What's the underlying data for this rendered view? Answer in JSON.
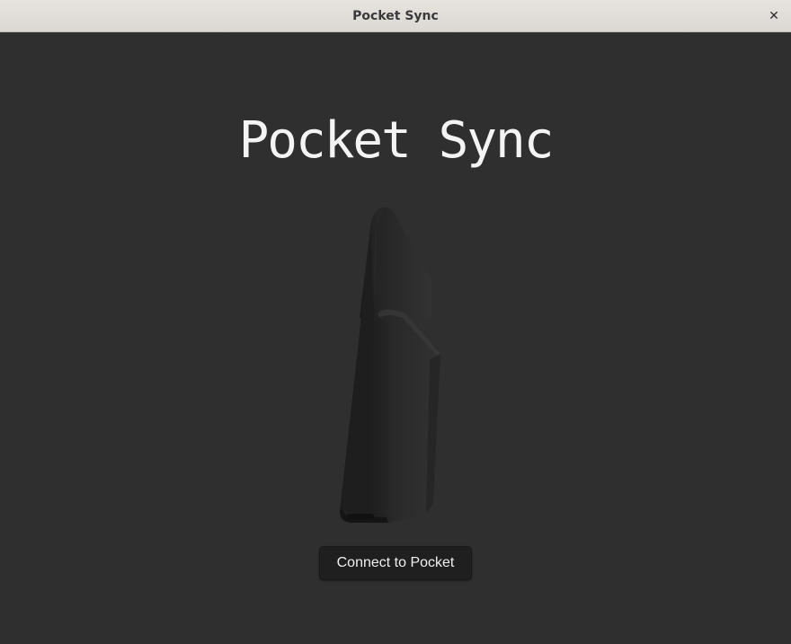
{
  "window": {
    "title": "Pocket Sync",
    "close_glyph": "✕"
  },
  "main": {
    "heading": "Pocket Sync",
    "device_image": "analogue-pocket-device",
    "connect_label": "Connect to Pocket"
  },
  "colors": {
    "background": "#2f2f2f",
    "titlebar": "#e0ddd9",
    "button": "#1f1f1f",
    "text": "#f4f4f4"
  }
}
